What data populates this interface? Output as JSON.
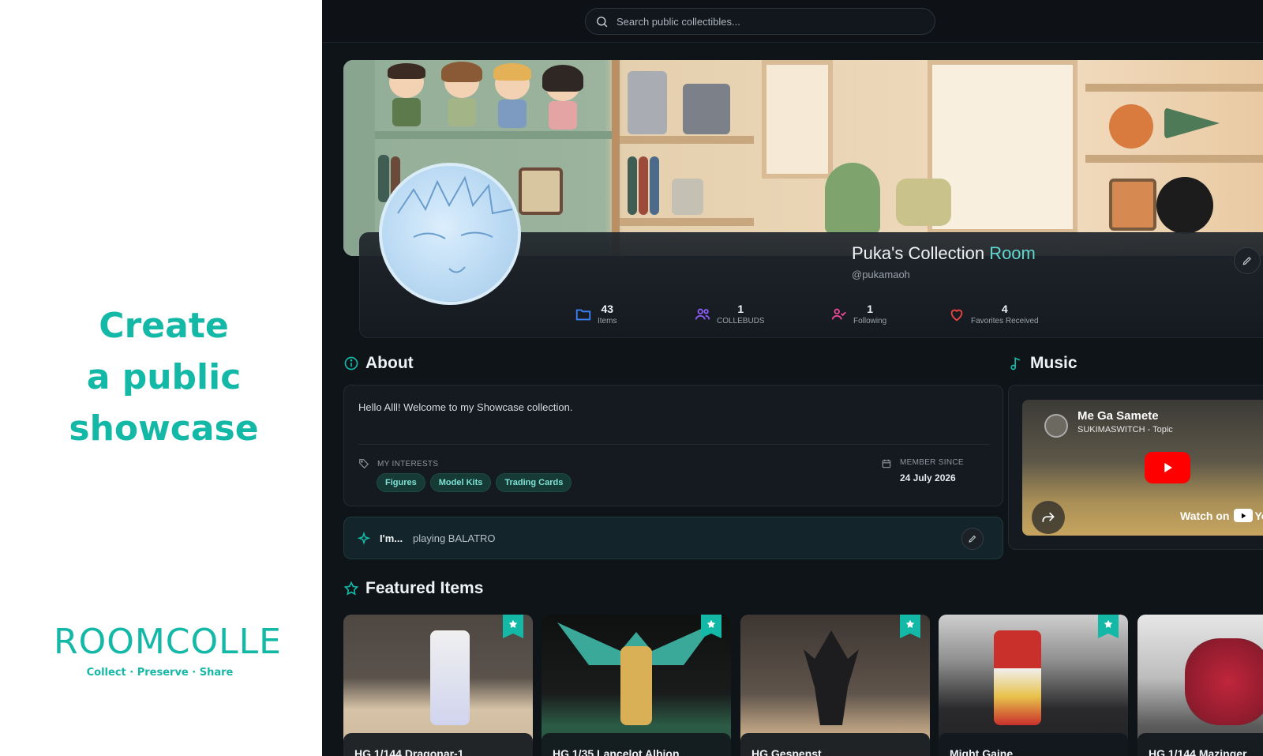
{
  "promo": {
    "headline": [
      "Create",
      "a public",
      "showcase"
    ],
    "logo": "ROOMCOLLE",
    "tagline": "Collect · Preserve · Share"
  },
  "search": {
    "placeholder": "Search public collectibles..."
  },
  "profile": {
    "name_main": "Puka's Collection ",
    "name_accent": "Room",
    "handle": "@pukamaoh"
  },
  "stats": [
    {
      "value": "43",
      "label": "Items",
      "icon": "folder-icon",
      "color": "#3b82f6"
    },
    {
      "value": "1",
      "label": "COLLEBUDS",
      "icon": "users-icon",
      "color": "#8b5cf6"
    },
    {
      "value": "1",
      "label": "Following",
      "icon": "user-check-icon",
      "color": "#ec4899"
    },
    {
      "value": "4",
      "label": "Favorites Received",
      "icon": "heart-icon",
      "color": "#ef4444"
    }
  ],
  "about": {
    "title": "About",
    "text": "Hello Alll! Welcome to my Showcase collection.",
    "interests_label": "MY INTERESTS",
    "interests": [
      "Figures",
      "Model Kits",
      "Trading Cards"
    ],
    "member_since_label": "MEMBER SINCE",
    "member_since": "24 July 2026"
  },
  "status": {
    "prefix": "I'm...",
    "text": "playing BALATRO"
  },
  "music": {
    "title": "Music",
    "video_title": "Me Ga Samete",
    "channel": "SUKIMASWITCH - Topic",
    "watch_on": "Watch on",
    "watch_brand": "Yo"
  },
  "featured": {
    "title": "Featured Items",
    "items": [
      {
        "name": "HG 1/144 Dragonar-1"
      },
      {
        "name": "HG 1/35 Lancelot Albion"
      },
      {
        "name": "HG Gespenst"
      },
      {
        "name": "Might Gaine"
      },
      {
        "name": "HG 1/144 Mazinger"
      }
    ]
  },
  "colors": {
    "accent": "#14b8a6",
    "background": "#0f1419",
    "card": "#141a1f"
  }
}
